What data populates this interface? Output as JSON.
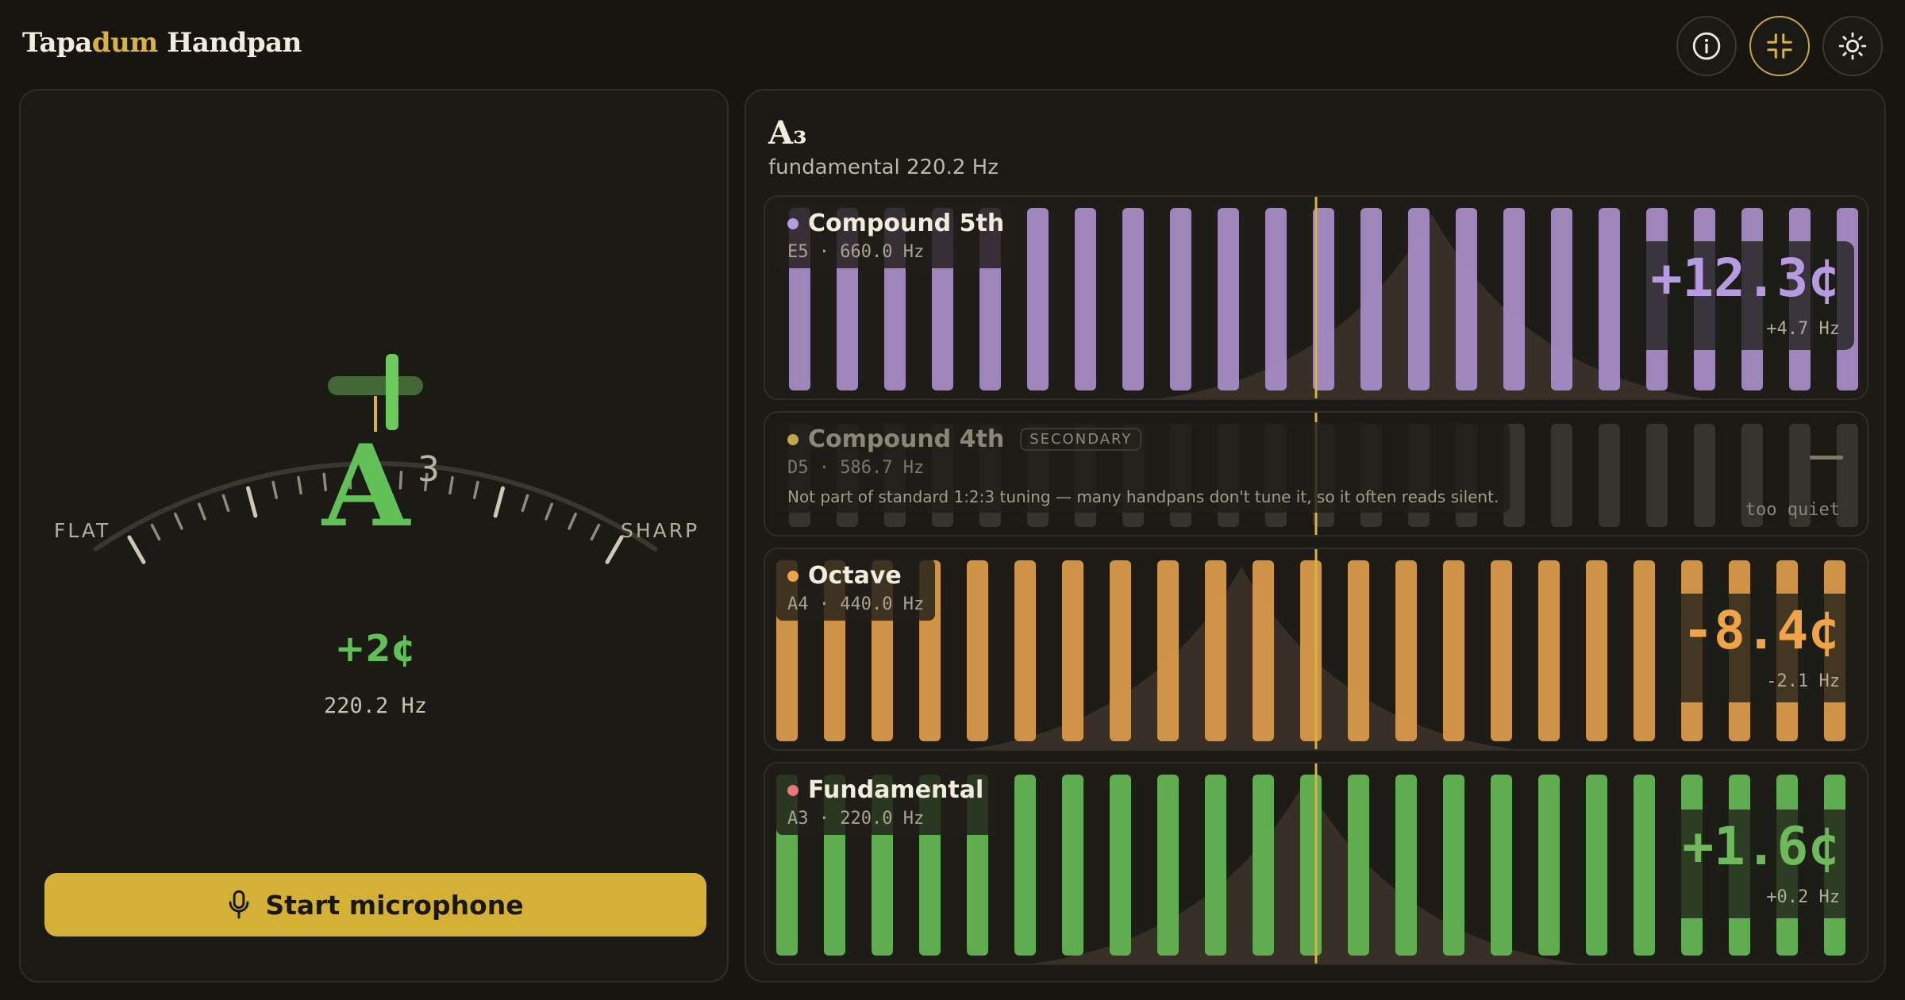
{
  "header": {
    "brand_pre": "Tapa",
    "brand_accent": "dum",
    "brand_post": " Handpan",
    "buttons": [
      {
        "name": "info",
        "icon": "info-icon"
      },
      {
        "name": "compact",
        "icon": "collapse-icon",
        "active": true
      },
      {
        "name": "theme",
        "icon": "sun-icon"
      }
    ]
  },
  "tuner": {
    "note": "A",
    "octave": "3",
    "cents": "+2¢",
    "hz": "220.2 Hz",
    "flat_label": "FLAT",
    "sharp_label": "SHARP",
    "mic_label": "Start microphone"
  },
  "partials": {
    "title": "A₃",
    "subtitle": "fundamental 220.2 Hz",
    "cards": [
      {
        "name": "Compound 5th",
        "sub": "E5 · 660.0 Hz",
        "cents": "+12.3¢",
        "hz": "+4.7 Hz",
        "color": "#a98fc9",
        "dot": "#b79be0"
      },
      {
        "name": "Compound 4th",
        "badge": "SECONDARY",
        "sub": "D5 · 586.7 Hz",
        "note": "Not part of standard 1:2:3 tuning — many handpans don't tune it, so it often reads silent.",
        "quiet": "too quiet",
        "dot": "#c2a64c"
      },
      {
        "name": "Octave",
        "sub": "A4 · 440.0 Hz",
        "cents": "-8.4¢",
        "hz": "-2.1 Hz",
        "color": "#e0a14f",
        "dot": "#f0a449"
      },
      {
        "name": "Fundamental",
        "sub": "A3 · 220.0 Hz",
        "cents": "+1.6¢",
        "hz": "+0.2 Hz",
        "color": "#6db95c",
        "dot": "#e4777a"
      }
    ]
  },
  "colors": {
    "accent": "#d5b037",
    "in_tune": "#62c058",
    "center_line": "#d9b246"
  }
}
